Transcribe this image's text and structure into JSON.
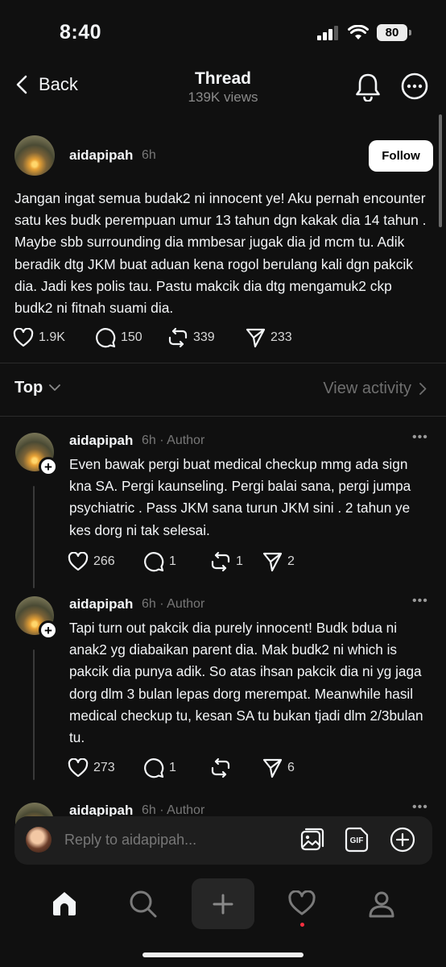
{
  "status_bar": {
    "time": "8:40",
    "battery": "80"
  },
  "header": {
    "back_label": "Back",
    "title": "Thread",
    "views": "139K views"
  },
  "post": {
    "username": "aidapipah",
    "time": "6h",
    "follow_label": "Follow",
    "text": "Jangan ingat semua budak2 ni innocent ye! Aku pernah encounter satu kes budk perempuan umur 13 tahun dgn kakak dia 14 tahun . Maybe sbb surrounding dia mmbesar jugak dia jd mcm tu. Adik beradik dtg JKM buat aduan kena rogol berulang kali dgn pakcik dia. Jadi kes polis tau. Pastu makcik dia dtg mengamuk2 ckp budk2 ni fitnah suami dia.",
    "likes": "1.9K",
    "comments": "150",
    "reposts": "339",
    "shares": "233"
  },
  "sort": {
    "label": "Top",
    "view_activity": "View activity"
  },
  "replies": [
    {
      "username": "aidapipah",
      "time": "6h",
      "badge": "· Author",
      "text": "Even bawak pergi buat medical checkup mmg ada sign kna SA. Pergi kaunseling. Pergi balai sana, pergi jumpa psychiatric . Pass JKM sana turun JKM sini . 2 tahun ye kes dorg ni tak selesai.",
      "likes": "266",
      "comments": "1",
      "reposts": "1",
      "shares": "2"
    },
    {
      "username": "aidapipah",
      "time": "6h",
      "badge": "· Author",
      "text": "Tapi turn out pakcik dia purely innocent! Budk bdua ni anak2 yg diabaikan parent dia. Mak budk2 ni which is pakcik dia punya adik. So atas ihsan pakcik dia ni yg jaga dorg dlm 3 bulan lepas dorg merempat. Meanwhile hasil medical checkup tu, kesan SA tu bukan tjadi dlm 2/3bulan tu.",
      "likes": "273",
      "comments": "1",
      "reposts": "",
      "shares": "6"
    },
    {
      "username": "aidapipah",
      "time": "6h",
      "badge": "· Author"
    }
  ],
  "reply_bar": {
    "placeholder": "Reply to aidapipah...",
    "gif_label": "GIF"
  },
  "icons": {
    "back": "chevron-left-icon",
    "bell": "bell-icon",
    "more": "more-circle-icon",
    "like": "heart-icon",
    "comment": "comment-icon",
    "repost": "repost-icon",
    "share": "send-icon"
  },
  "colors": {
    "background": "#101010",
    "muted": "#777777",
    "notification_dot": "#ff3040"
  }
}
